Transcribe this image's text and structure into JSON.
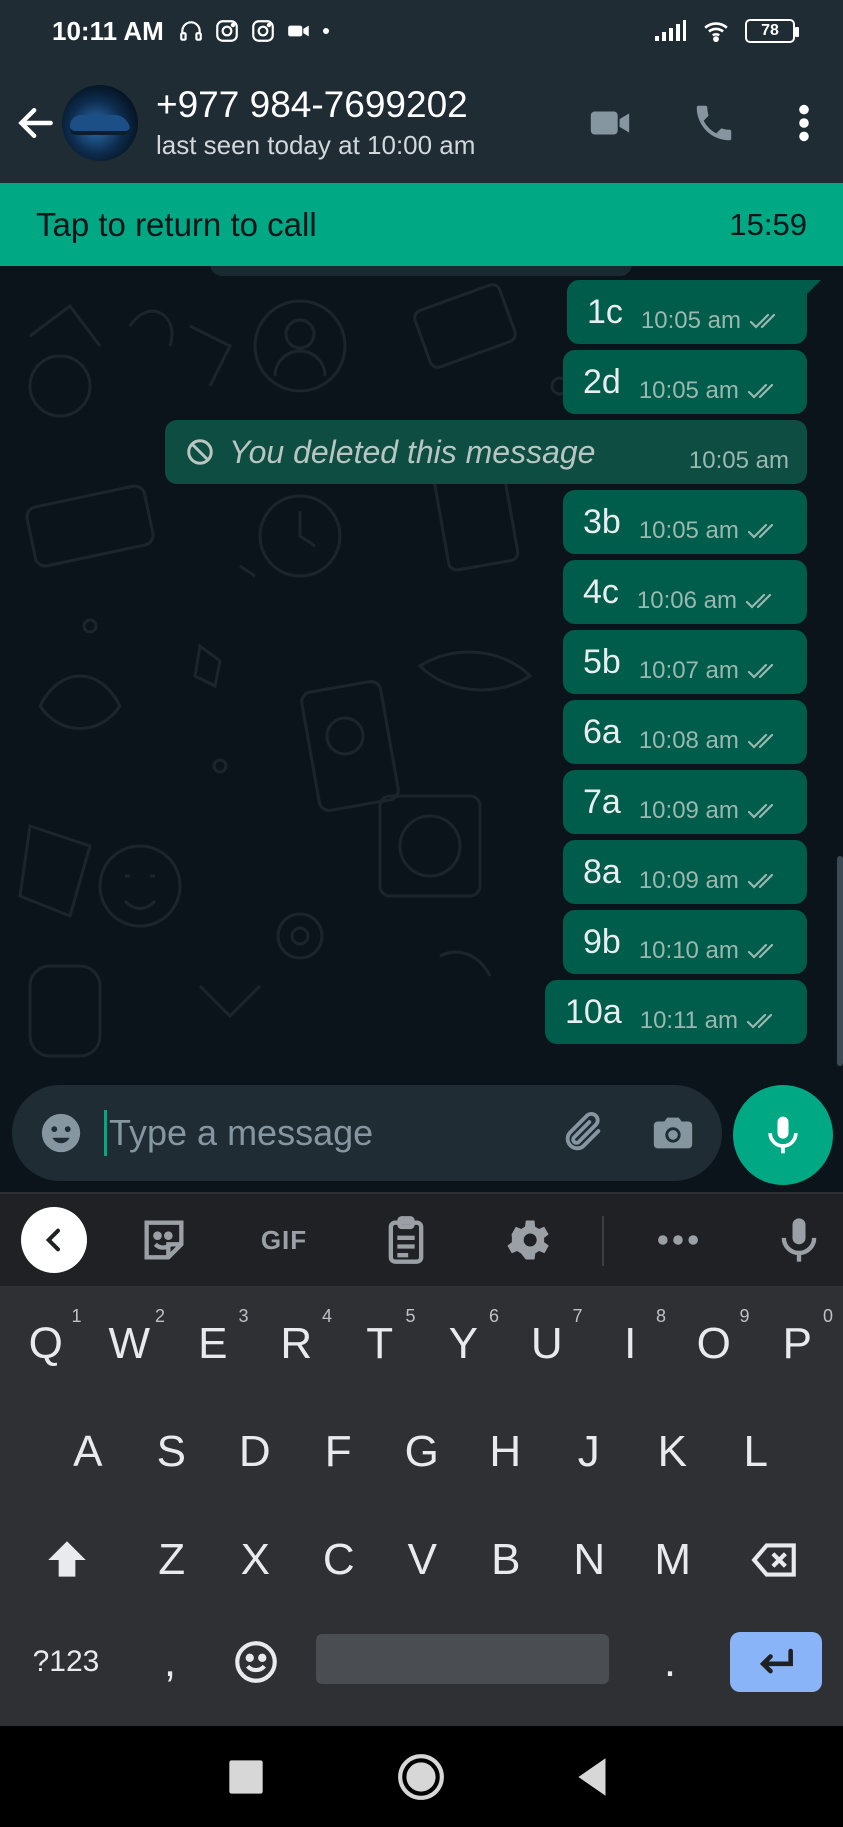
{
  "status_bar": {
    "time": "10:11 AM",
    "battery": "78",
    "icons": [
      "headset-icon",
      "instagram-icon",
      "instagram-icon",
      "video-camera-icon",
      "dot-icon",
      "signal-icon",
      "wifi-icon",
      "battery-icon"
    ]
  },
  "header": {
    "contact_name": "+977 984-7699202",
    "last_seen": "last seen today at 10:00 am",
    "icons": [
      "back-arrow-icon",
      "video-call-icon",
      "voice-call-icon",
      "more-vert-icon"
    ]
  },
  "call_banner": {
    "label": "Tap to return to call",
    "timer": "15:59"
  },
  "messages": [
    {
      "text": "1c",
      "time": "10:05 am",
      "status": "read-ticks"
    },
    {
      "text": "2d",
      "time": "10:05 am",
      "status": "read-ticks"
    },
    {
      "text": "You deleted this message",
      "time": "10:05 am",
      "status": "deleted"
    },
    {
      "text": "3b",
      "time": "10:05 am",
      "status": "read-ticks"
    },
    {
      "text": "4c",
      "time": "10:06 am",
      "status": "read-ticks"
    },
    {
      "text": "5b",
      "time": "10:07 am",
      "status": "read-ticks"
    },
    {
      "text": "6a",
      "time": "10:08 am",
      "status": "read-ticks"
    },
    {
      "text": "7a",
      "time": "10:09 am",
      "status": "read-ticks"
    },
    {
      "text": "8a",
      "time": "10:09 am",
      "status": "read-ticks"
    },
    {
      "text": "9b",
      "time": "10:10 am",
      "status": "read-ticks"
    },
    {
      "text": "10a",
      "time": "10:11 am",
      "status": "read-ticks"
    }
  ],
  "composer": {
    "placeholder": "Type a message",
    "icons": [
      "emoji-icon",
      "attach-icon",
      "camera-icon",
      "mic-icon"
    ]
  },
  "keyboard_toolbar": {
    "gif_label": "GIF",
    "icons": [
      "collapse-icon",
      "sticker-icon",
      "clipboard-icon",
      "settings-icon",
      "more-horiz-icon",
      "voice-input-icon"
    ]
  },
  "keyboard": {
    "row1": [
      {
        "k": "Q",
        "n": "1"
      },
      {
        "k": "W",
        "n": "2"
      },
      {
        "k": "E",
        "n": "3"
      },
      {
        "k": "R",
        "n": "4"
      },
      {
        "k": "T",
        "n": "5"
      },
      {
        "k": "Y",
        "n": "6"
      },
      {
        "k": "U",
        "n": "7"
      },
      {
        "k": "I",
        "n": "8"
      },
      {
        "k": "O",
        "n": "9"
      },
      {
        "k": "P",
        "n": "0"
      }
    ],
    "row2": [
      "A",
      "S",
      "D",
      "F",
      "G",
      "H",
      "J",
      "K",
      "L"
    ],
    "row3": [
      "Z",
      "X",
      "C",
      "V",
      "B",
      "N",
      "M"
    ],
    "symbols_label": "?123",
    "comma": ",",
    "period": "."
  },
  "nav_bar": {
    "icons": [
      "recents-icon",
      "home-icon",
      "back-icon"
    ]
  }
}
